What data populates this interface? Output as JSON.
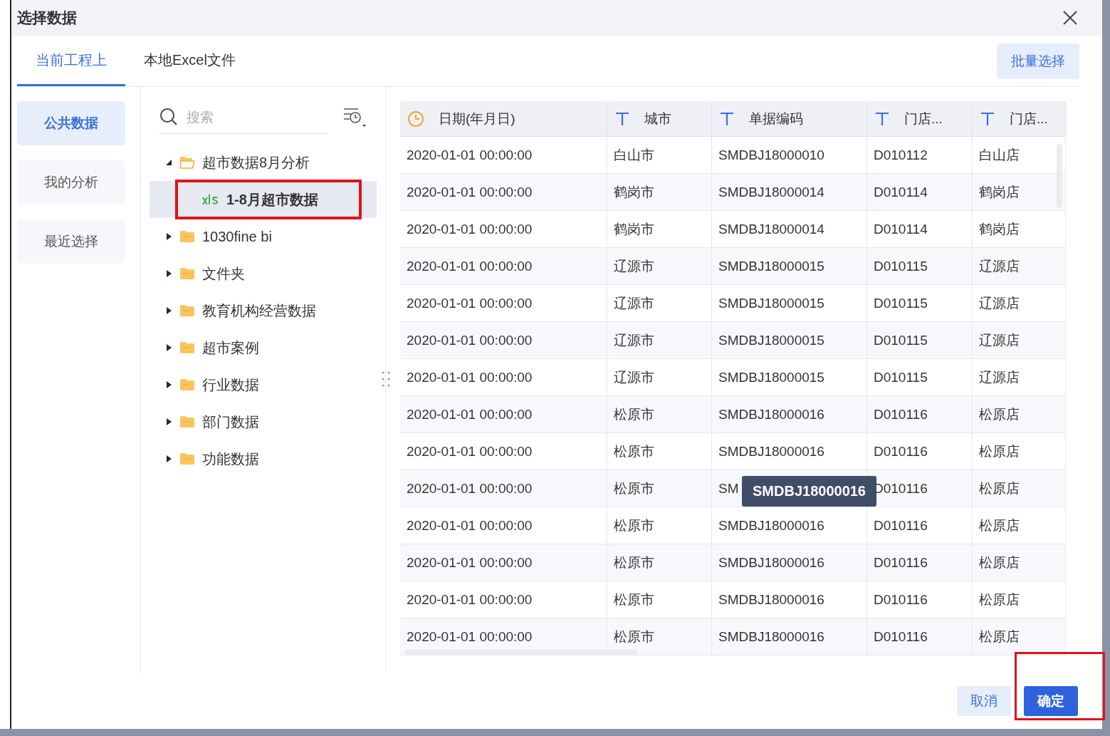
{
  "window": {
    "title": "选择数据"
  },
  "tabs": [
    {
      "label": "当前工程上",
      "selected": true
    },
    {
      "label": "本地Excel文件",
      "selected": false
    }
  ],
  "batch_button": "批量选择",
  "nav": [
    {
      "label": "公共数据",
      "selected": true
    },
    {
      "label": "我的分析",
      "selected": false
    },
    {
      "label": "最近选择",
      "selected": false
    }
  ],
  "search": {
    "placeholder": "搜索"
  },
  "tree": [
    {
      "kind": "folder",
      "label": "超市数据8月分析",
      "expanded": true,
      "selected": false,
      "children": [
        {
          "kind": "xls",
          "label": "1-8月超市数据",
          "selected": true,
          "highlighted": true
        }
      ]
    },
    {
      "kind": "folder",
      "label": "1030fine bi",
      "expanded": false,
      "selected": false
    },
    {
      "kind": "folder",
      "label": "文件夹",
      "expanded": false,
      "selected": false
    },
    {
      "kind": "folder",
      "label": "教育机构经营数据",
      "expanded": false,
      "selected": false
    },
    {
      "kind": "folder",
      "label": "超市案例",
      "expanded": false,
      "selected": false
    },
    {
      "kind": "folder",
      "label": "行业数据",
      "expanded": false,
      "selected": false
    },
    {
      "kind": "folder",
      "label": "部门数据",
      "expanded": false,
      "selected": false
    },
    {
      "kind": "folder",
      "label": "功能数据",
      "expanded": false,
      "selected": false
    }
  ],
  "table": {
    "columns": [
      {
        "kind": "date",
        "label": "日期(年月日)"
      },
      {
        "kind": "text",
        "label": "城市"
      },
      {
        "kind": "text",
        "label": "单据编码"
      },
      {
        "kind": "text",
        "label": "门店..."
      },
      {
        "kind": "text",
        "label": "门店..."
      }
    ],
    "rows": [
      {
        "cells": [
          "2020-01-01 00:00:00",
          "白山市",
          "SMDBJ18000010",
          "D010112",
          "白山店"
        ]
      },
      {
        "cells": [
          "2020-01-01 00:00:00",
          "鹤岗市",
          "SMDBJ18000014",
          "D010114",
          "鹤岗店"
        ]
      },
      {
        "cells": [
          "2020-01-01 00:00:00",
          "鹤岗市",
          "SMDBJ18000014",
          "D010114",
          "鹤岗店"
        ]
      },
      {
        "cells": [
          "2020-01-01 00:00:00",
          "辽源市",
          "SMDBJ18000015",
          "D010115",
          "辽源店"
        ]
      },
      {
        "cells": [
          "2020-01-01 00:00:00",
          "辽源市",
          "SMDBJ18000015",
          "D010115",
          "辽源店"
        ]
      },
      {
        "cells": [
          "2020-01-01 00:00:00",
          "辽源市",
          "SMDBJ18000015",
          "D010115",
          "辽源店"
        ]
      },
      {
        "cells": [
          "2020-01-01 00:00:00",
          "辽源市",
          "SMDBJ18000015",
          "D010115",
          "辽源店"
        ]
      },
      {
        "cells": [
          "2020-01-01 00:00:00",
          "松原市",
          "SMDBJ18000016",
          "D010116",
          "松原店"
        ]
      },
      {
        "cells": [
          "2020-01-01 00:00:00",
          "松原市",
          "SMDBJ18000016",
          "D010116",
          "松原店"
        ]
      },
      {
        "cells": [
          "2020-01-01 00:00:00",
          "松原市",
          "SM",
          "D010116",
          "松原店"
        ],
        "tooltip": "SMDBJ18000016"
      },
      {
        "cells": [
          "2020-01-01 00:00:00",
          "松原市",
          "SMDBJ18000016",
          "D010116",
          "松原店"
        ]
      },
      {
        "cells": [
          "2020-01-01 00:00:00",
          "松原市",
          "SMDBJ18000016",
          "D010116",
          "松原店"
        ]
      },
      {
        "cells": [
          "2020-01-01 00:00:00",
          "松原市",
          "SMDBJ18000016",
          "D010116",
          "松原店"
        ]
      },
      {
        "cells": [
          "2020-01-01 00:00:00",
          "松原市",
          "SMDBJ18000016",
          "D010116",
          "松原店"
        ]
      }
    ]
  },
  "footer": {
    "buttons": [
      {
        "kind": "secondary",
        "label": "取消"
      },
      {
        "kind": "primary",
        "label": "确定",
        "highlighted": true
      }
    ]
  }
}
